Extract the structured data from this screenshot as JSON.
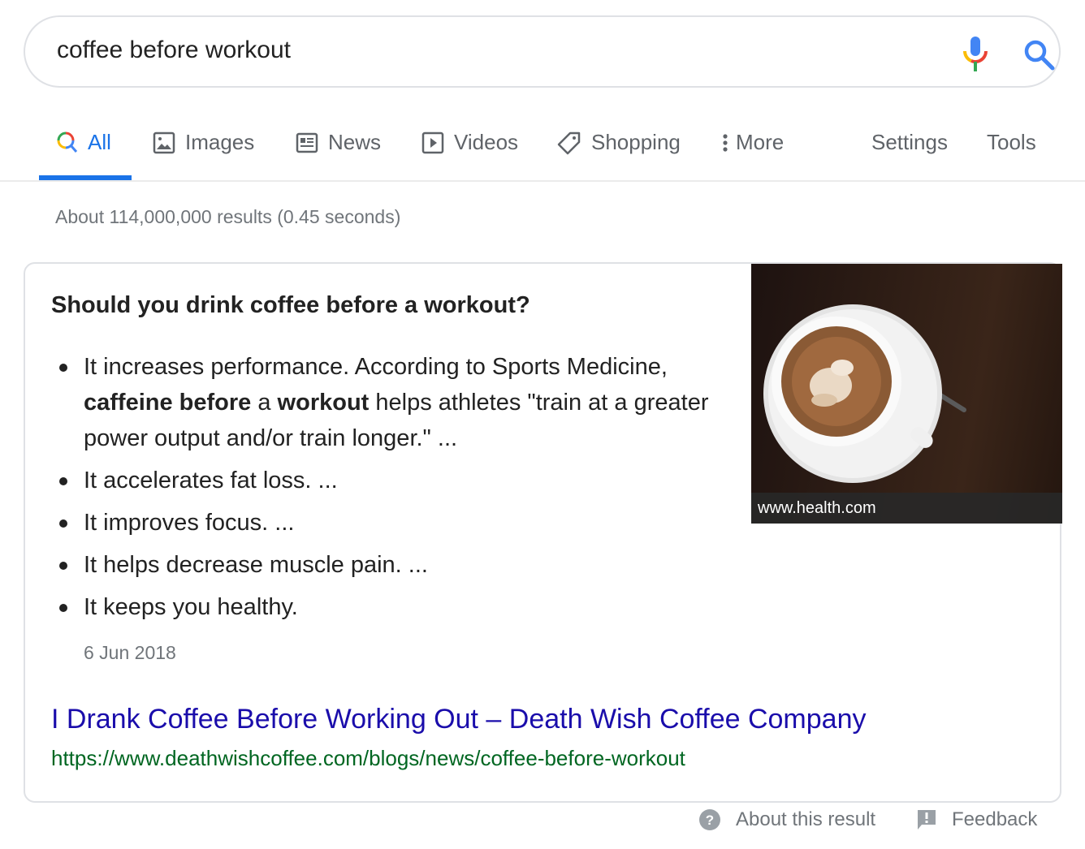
{
  "search": {
    "query": "coffee before workout",
    "mic_icon": "microphone-icon",
    "search_icon": "search-icon"
  },
  "tabs": [
    {
      "label": "All",
      "icon": "search-icon",
      "active": true
    },
    {
      "label": "Images",
      "icon": "image-icon"
    },
    {
      "label": "News",
      "icon": "newspaper-icon"
    },
    {
      "label": "Videos",
      "icon": "play-icon"
    },
    {
      "label": "Shopping",
      "icon": "tag-icon"
    },
    {
      "label": "More",
      "icon": "more-vert-icon"
    },
    {
      "label": "Settings"
    },
    {
      "label": "Tools"
    }
  ],
  "stats": "About 114,000,000 results (0.45 seconds)",
  "snippet": {
    "question": "Should you drink coffee before a workout?",
    "items": [
      {
        "parts": [
          {
            "t": "It increases performance. According to Sports Medicine, ",
            "b": false
          },
          {
            "t": "caffeine before",
            "b": true
          },
          {
            "t": " a ",
            "b": false
          },
          {
            "t": "workout",
            "b": true
          },
          {
            "t": " helps athletes \"train at a greater power output and/or train longer.\" ...",
            "b": false
          }
        ]
      },
      {
        "parts": [
          {
            "t": "It accelerates fat loss. ...",
            "b": false
          }
        ]
      },
      {
        "parts": [
          {
            "t": "It improves focus. ...",
            "b": false
          }
        ]
      },
      {
        "parts": [
          {
            "t": "It helps decrease muscle pain. ...",
            "b": false
          }
        ]
      },
      {
        "parts": [
          {
            "t": "It keeps you healthy.",
            "b": false
          }
        ]
      }
    ],
    "date": "6 Jun 2018",
    "image_caption": "www.health.com",
    "result_title": "I Drank Coffee Before Working Out – Death Wish Coffee Company",
    "result_url": "https://www.deathwishcoffee.com/blogs/news/coffee-before-workout"
  },
  "footer": {
    "about": "About this result",
    "feedback": "Feedback"
  },
  "colors": {
    "accent": "#1a73e8",
    "link": "#1a0dab",
    "url": "#006621",
    "muted": "#70757a"
  }
}
